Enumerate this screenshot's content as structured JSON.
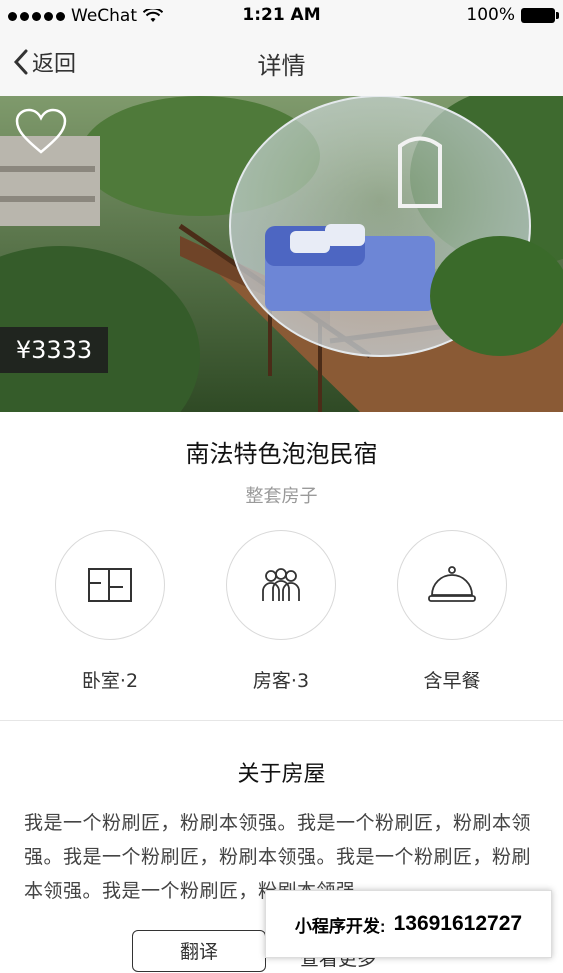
{
  "status_bar": {
    "carrier": "WeChat",
    "time": "1:21 AM",
    "battery": "100%"
  },
  "nav": {
    "back_label": "返回",
    "title": "详情"
  },
  "listing": {
    "price": "¥3333",
    "title": "南法特色泡泡民宿",
    "type": "整套房子",
    "features": [
      {
        "icon": "bedroom-icon",
        "label": "卧室·2"
      },
      {
        "icon": "guests-icon",
        "label": "房客·3"
      },
      {
        "icon": "breakfast-icon",
        "label": "含早餐"
      }
    ],
    "about_title": "关于房屋",
    "about_text": "我是一个粉刷匠，粉刷本领强。我是一个粉刷匠，粉刷本领强。我是一个粉刷匠，粉刷本领强。我是一个粉刷匠，粉刷本领强。我是一个粉刷匠，粉刷本领强。",
    "translate_label": "翻译",
    "extra_label": "查看更多"
  },
  "banner": {
    "label": "小程序开发:",
    "phone": "13691612727"
  }
}
